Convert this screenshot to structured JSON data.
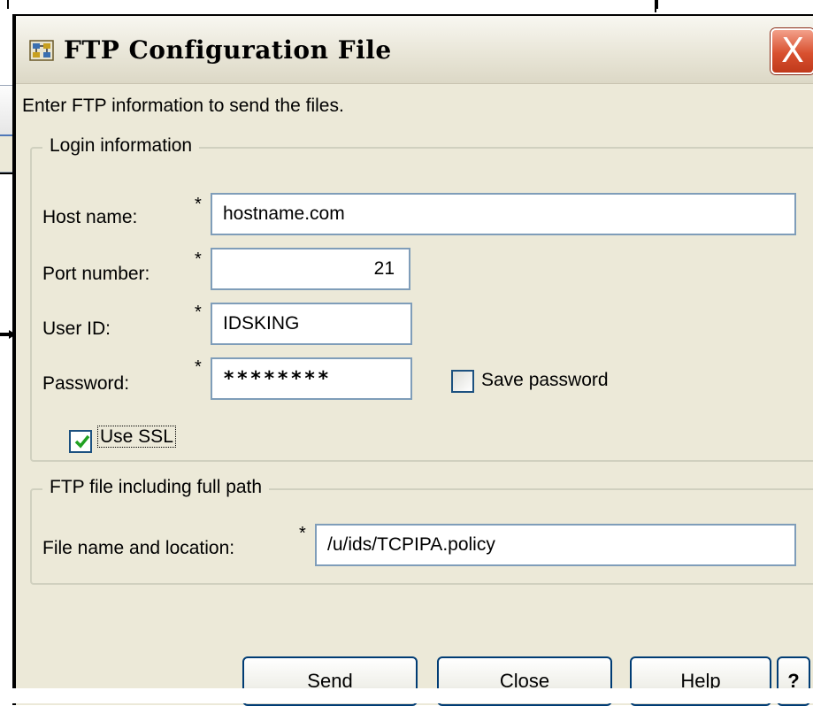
{
  "dialog": {
    "title": "FTP Configuration File",
    "close_label": "X",
    "instruction": "Enter FTP information to send the files."
  },
  "login_group": {
    "legend": "Login information",
    "required_marker": "*",
    "host_label": "Host name:",
    "host_value": "hostname.com",
    "port_label": "Port number:",
    "port_value": "21",
    "userid_label": "User ID:",
    "userid_value": "IDSKING",
    "password_label": "Password:",
    "password_value": "********",
    "save_password_label": "Save password",
    "save_password_checked": false,
    "use_ssl_label": "Use SSL",
    "use_ssl_checked": true
  },
  "ftp_group": {
    "legend": "FTP file including full path",
    "file_label": "File name and location:",
    "file_value": "/u/ids/TCPIPA.policy"
  },
  "buttons": {
    "send": "Send",
    "close": "Close",
    "help": "Help",
    "context_help": "?"
  },
  "icons": {
    "title": "ftp-config-icon",
    "close": "close-icon",
    "check": "checkmark-icon"
  },
  "colors": {
    "window_bg": "#ece9d8",
    "close_button": "#d8502f",
    "checkbox_border": "#1c5180",
    "check_green": "#21a121",
    "field_border": "#7f9db9"
  }
}
